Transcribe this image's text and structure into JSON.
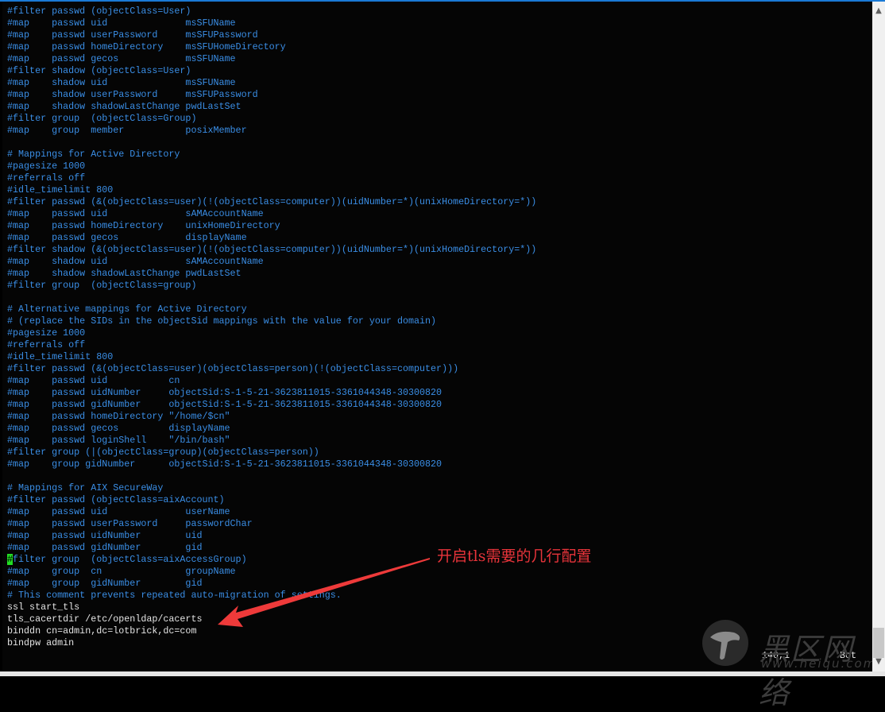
{
  "editor": {
    "lines": [
      "#filter passwd (objectClass=User)",
      "#map    passwd uid              msSFUName",
      "#map    passwd userPassword     msSFUPassword",
      "#map    passwd homeDirectory    msSFUHomeDirectory",
      "#map    passwd gecos            msSFUName",
      "#filter shadow (objectClass=User)",
      "#map    shadow uid              msSFUName",
      "#map    shadow userPassword     msSFUPassword",
      "#map    shadow shadowLastChange pwdLastSet",
      "#filter group  (objectClass=Group)",
      "#map    group  member           posixMember",
      "",
      "# Mappings for Active Directory",
      "#pagesize 1000",
      "#referrals off",
      "#idle_timelimit 800",
      "#filter passwd (&(objectClass=user)(!(objectClass=computer))(uidNumber=*)(unixHomeDirectory=*))",
      "#map    passwd uid              sAMAccountName",
      "#map    passwd homeDirectory    unixHomeDirectory",
      "#map    passwd gecos            displayName",
      "#filter shadow (&(objectClass=user)(!(objectClass=computer))(uidNumber=*)(unixHomeDirectory=*))",
      "#map    shadow uid              sAMAccountName",
      "#map    shadow shadowLastChange pwdLastSet",
      "#filter group  (objectClass=group)",
      "",
      "# Alternative mappings for Active Directory",
      "# (replace the SIDs in the objectSid mappings with the value for your domain)",
      "#pagesize 1000",
      "#referrals off",
      "#idle_timelimit 800",
      "#filter passwd (&(objectClass=user)(objectClass=person)(!(objectClass=computer)))",
      "#map    passwd uid           cn",
      "#map    passwd uidNumber     objectSid:S-1-5-21-3623811015-3361044348-30300820",
      "#map    passwd gidNumber     objectSid:S-1-5-21-3623811015-3361044348-30300820",
      "#map    passwd homeDirectory \"/home/$cn\"",
      "#map    passwd gecos         displayName",
      "#map    passwd loginShell    \"/bin/bash\"",
      "#filter group (|(objectClass=group)(objectClass=person))",
      "#map    group gidNumber      objectSid:S-1-5-21-3623811015-3361044348-30300820",
      "",
      "# Mappings for AIX SecureWay",
      "#filter passwd (objectClass=aixAccount)",
      "#map    passwd uid              userName",
      "#map    passwd userPassword     passwordChar",
      "#map    passwd uidNumber        uid",
      "#map    passwd gidNumber        gid",
      "#filter group  (objectClass=aixAccessGroup)",
      "#map    group  cn               groupName",
      "#map    group  gidNumber        gid",
      "# This comment prevents repeated auto-migration of settings.",
      "ssl start_tls",
      "tls_cacertdir /etc/openldap/cacerts",
      "binddn cn=admin,dc=lotbrick,dc=com",
      "bindpw admin"
    ],
    "cursor": {
      "line": 46,
      "col": 0
    }
  },
  "status": {
    "position": "140,1",
    "scroll": "Bot"
  },
  "annotation": {
    "text": "开启tls需要的几行配置",
    "color": "#e8343a"
  },
  "watermark": {
    "text": "黑区网络",
    "url": "www.heiqu.com"
  },
  "colors": {
    "comment": "#3a8ee6",
    "plain": "#e4e4e4",
    "cursor": "#22dd22",
    "background": "#050505"
  },
  "scrollbar": {
    "up_icon": "chevron-up-icon",
    "down_icon": "chevron-down-icon"
  }
}
